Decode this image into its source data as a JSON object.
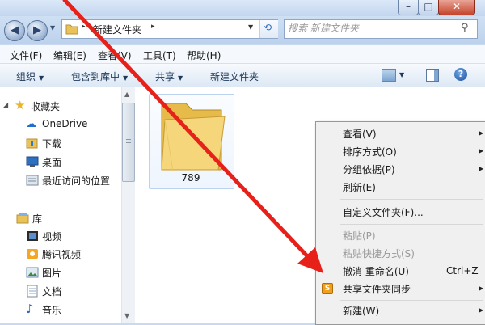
{
  "address": {
    "folder_name": "新建文件夹",
    "search_placeholder": "搜索 新建文件夹"
  },
  "menubar": [
    "文件(F)",
    "编辑(E)",
    "查看(V)",
    "工具(T)",
    "帮助(H)"
  ],
  "commandbar": {
    "organize": "组织",
    "include_in_library": "包含到库中",
    "share": "共享",
    "new_folder": "新建文件夹"
  },
  "nav": {
    "favorites_header": "收藏夹",
    "favorites": [
      "OneDrive",
      "下载",
      "桌面",
      "最近访问的位置"
    ],
    "libraries_header": "库",
    "libraries": [
      "视频",
      "腾讯视频",
      "图片",
      "文档",
      "音乐"
    ]
  },
  "content": {
    "folder_label": "789"
  },
  "context_menu": {
    "items": [
      {
        "label": "查看(V)",
        "submenu": true
      },
      {
        "label": "排序方式(O)",
        "submenu": true
      },
      {
        "label": "分组依据(P)",
        "submenu": true
      },
      {
        "label": "刷新(E)",
        "submenu": false
      },
      {
        "label": "自定义文件夹(F)...",
        "submenu": false
      },
      {
        "label": "粘贴(P)",
        "submenu": false,
        "disabled": true
      },
      {
        "label": "粘贴快捷方式(S)",
        "submenu": false,
        "disabled": true
      },
      {
        "label": "撤消 重命名(U)",
        "shortcut": "Ctrl+Z"
      },
      {
        "label": "共享文件夹同步",
        "submenu": true
      },
      {
        "label": "新建(W)",
        "submenu": true
      }
    ]
  },
  "colors": {
    "arrow": "#e8201a",
    "folder": "#f2c94c",
    "chrome": "#c9daf0"
  }
}
